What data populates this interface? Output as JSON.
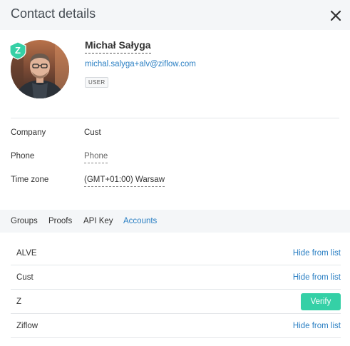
{
  "header": {
    "title": "Contact details",
    "close_icon": "close-icon"
  },
  "profile": {
    "badge_letter": "Z",
    "badge_color": "#35d0a6",
    "name": "Michał Sałyga",
    "email": "michal.salyga+alv@ziflow.com",
    "role": "USER"
  },
  "fields": {
    "company": {
      "label": "Company",
      "value": "Cust"
    },
    "phone": {
      "label": "Phone",
      "value": "Phone"
    },
    "timezone": {
      "label": "Time zone",
      "value": "(GMT+01:00) Warsaw"
    }
  },
  "tabs": [
    {
      "label": "Groups",
      "active": false
    },
    {
      "label": "Proofs",
      "active": false
    },
    {
      "label": "API Key",
      "active": false
    },
    {
      "label": "Accounts",
      "active": true
    }
  ],
  "accounts": [
    {
      "name": "ALVE",
      "action": "Hide from list"
    },
    {
      "name": "Cust",
      "action": "Hide from list"
    },
    {
      "name": "Z",
      "action": "Verify"
    },
    {
      "name": "Ziflow",
      "action": "Hide from list"
    }
  ],
  "colors": {
    "accent": "#2a7fc3",
    "success": "#35d0a6",
    "panel": "#f4f6f8"
  }
}
